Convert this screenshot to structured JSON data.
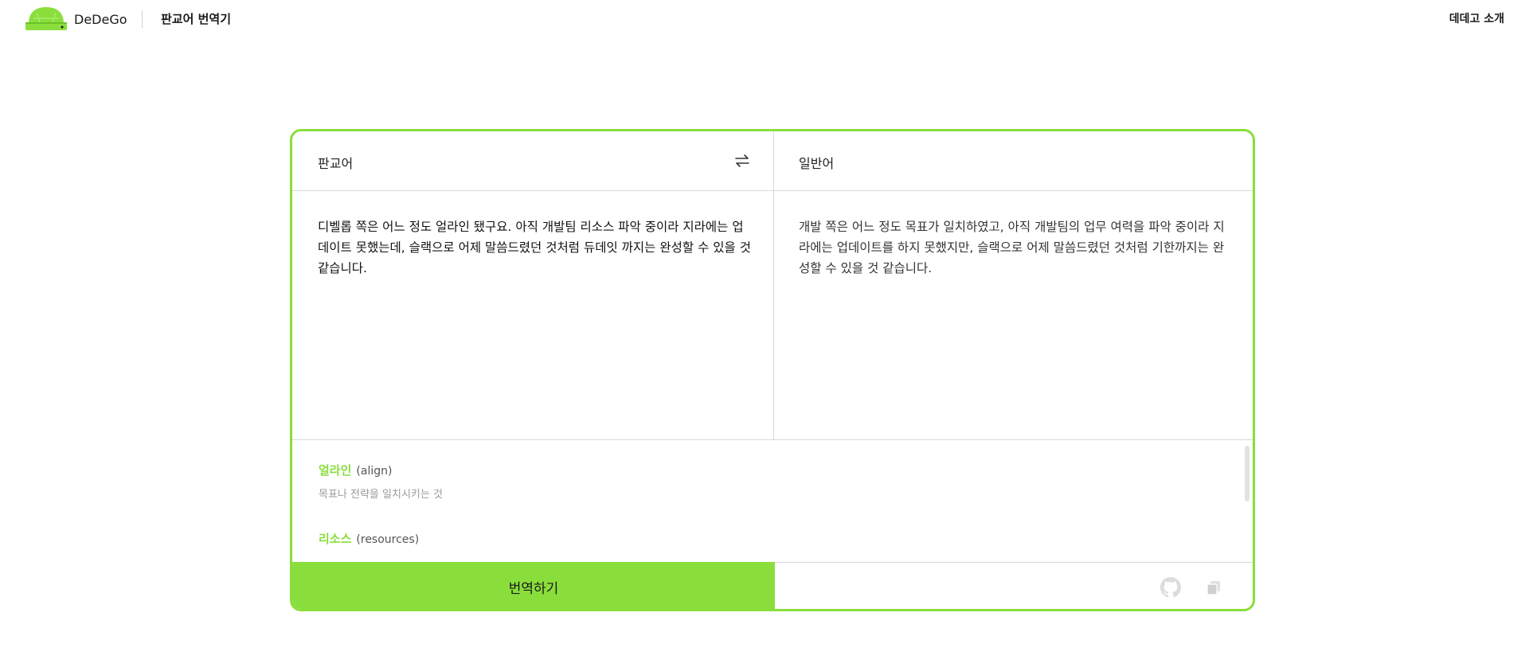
{
  "header": {
    "brand": "DeDeGo",
    "page_title": "판교어 번역기",
    "about": "데데고 소개"
  },
  "translator": {
    "source_lang": "판교어",
    "target_lang": "일반어",
    "source_text": "디벨롭 쪽은 어느 정도 얼라인 됐구요. 아직 개발팀 리소스 파악 중이라 지라에는 업데이트 못했는데, 슬랙으로 어제 말씀드렸던 것처럼 듀데잇 까지는 완성할 수 있을 것 같습니다.",
    "result_text": "개발 쪽은 어느 정도 목표가 일치하였고, 아직 개발팀의 업무 여력을 파악 중이라 지라에는 업데이트를 하지 못했지만, 슬랙으로 어제 말씀드렸던 것처럼 기한까지는 완성할 수 있을 것 같습니다.",
    "translate_label": "번역하기"
  },
  "glossary": [
    {
      "word": "얼라인",
      "english": "(align)",
      "definition": "목표나 전략을 일치시키는 것"
    },
    {
      "word": "리소스",
      "english": "(resources)",
      "definition": ""
    }
  ],
  "icons": {
    "logo": "turtle-shell-logo-icon",
    "swap": "swap-arrows-icon",
    "github": "github-icon",
    "copy": "copy-icon"
  },
  "colors": {
    "accent": "#8ade3c",
    "border": "#d8d8d8",
    "definition": "#9a9a9a"
  }
}
